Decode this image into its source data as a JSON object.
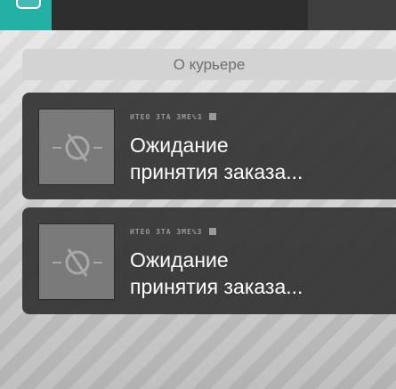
{
  "courier_button": {
    "label": "О курьере"
  },
  "orders": [
    {
      "meta": "ИТЕО ЗТА ЗМЕ%З",
      "title_line1": "Ожидание",
      "title_line2": "принятия заказа..."
    },
    {
      "meta": "ИТЕО ЗТА ЗМЕ%З",
      "title_line1": "Ожидание",
      "title_line2": "принятия заказа..."
    }
  ],
  "icons": {
    "thumb_placeholder": "no-image-icon"
  },
  "colors": {
    "accent": "#25b0a6",
    "card_bg": "#323232",
    "button_bg": "#d3d3d3",
    "button_text": "#6e6e6e"
  }
}
